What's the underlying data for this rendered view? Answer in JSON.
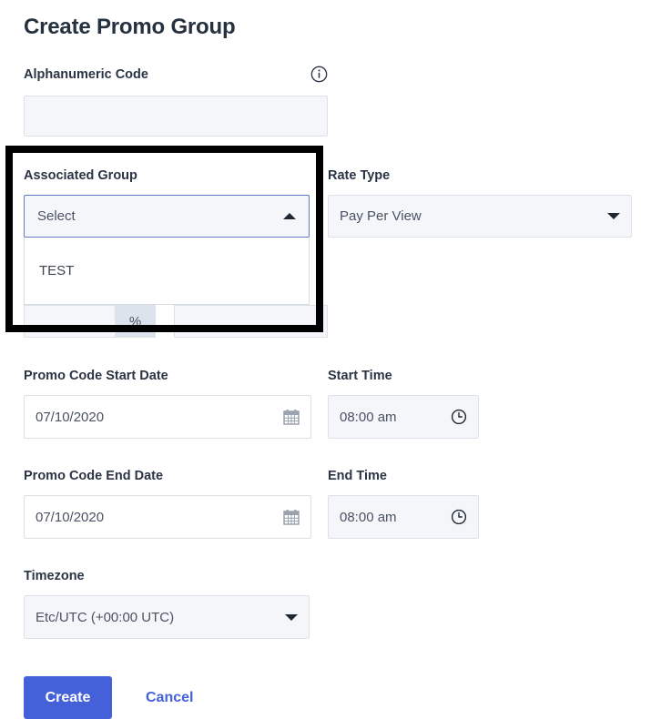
{
  "form": {
    "title": "Create Promo Group",
    "alphanumeric": {
      "label": "Alphanumeric Code",
      "info_icon": "info-circle-icon",
      "value": "",
      "placeholder": ""
    },
    "associated_group": {
      "label": "Associated Group",
      "selected": "Select",
      "expanded": true,
      "caret_icon": "caret-up-icon",
      "options": [
        "TEST"
      ]
    },
    "rate_type": {
      "label": "Rate Type",
      "selected": "Pay Per View",
      "caret_icon": "caret-down-icon"
    },
    "discount_row": {
      "suffix": "%",
      "value": "",
      "second_value": ""
    },
    "start_date": {
      "label": "Promo Code Start Date",
      "value": "07/10/2020",
      "icon": "calendar-icon"
    },
    "start_time": {
      "label": "Start Time",
      "value": "08:00 am",
      "icon": "clock-icon"
    },
    "end_date": {
      "label": "Promo Code End Date",
      "value": "07/10/2020",
      "icon": "calendar-icon"
    },
    "end_time": {
      "label": "End Time",
      "value": "08:00 am",
      "icon": "clock-icon"
    },
    "timezone": {
      "label": "Timezone",
      "selected": "Etc/UTC (+00:00 UTC)",
      "caret_icon": "caret-down-icon"
    },
    "actions": {
      "create_label": "Create",
      "cancel_label": "Cancel"
    }
  },
  "annotation": {
    "highlight_target": "associated-group-dropdown",
    "border_color": "#000000"
  },
  "colors": {
    "accent": "#4461d9",
    "input_bg": "#f4f6fa",
    "input_border": "#dde1e8",
    "focus_border": "#6179c4",
    "text": "#2b3445"
  }
}
